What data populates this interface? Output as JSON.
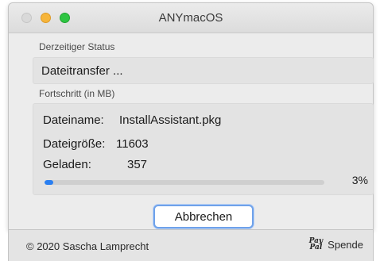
{
  "window": {
    "title": "ANYmacOS"
  },
  "status": {
    "section_label": "Derzeitiger Status",
    "value": "Dateitransfer ..."
  },
  "progress": {
    "section_label": "Fortschritt (in MB)",
    "filename_label": "Dateiname:",
    "filename_value": "InstallAssistant.pkg",
    "filesize_label": "Dateigröße:",
    "filesize_value": "11603",
    "loaded_label": "Geladen:",
    "loaded_value": "357",
    "percent_text": "3%",
    "percent_value": 0.03
  },
  "actions": {
    "cancel_label": "Abbrechen"
  },
  "footer": {
    "copyright": "© 2020 Sascha Lamprecht",
    "donate_label": "Spende",
    "paypal_line1": "Pay",
    "paypal_line2": "Pal"
  },
  "colors": {
    "accent": "#2a7ff1",
    "close": "#d9d9d9",
    "minimize": "#f6b53b",
    "zoom": "#2ec542"
  }
}
